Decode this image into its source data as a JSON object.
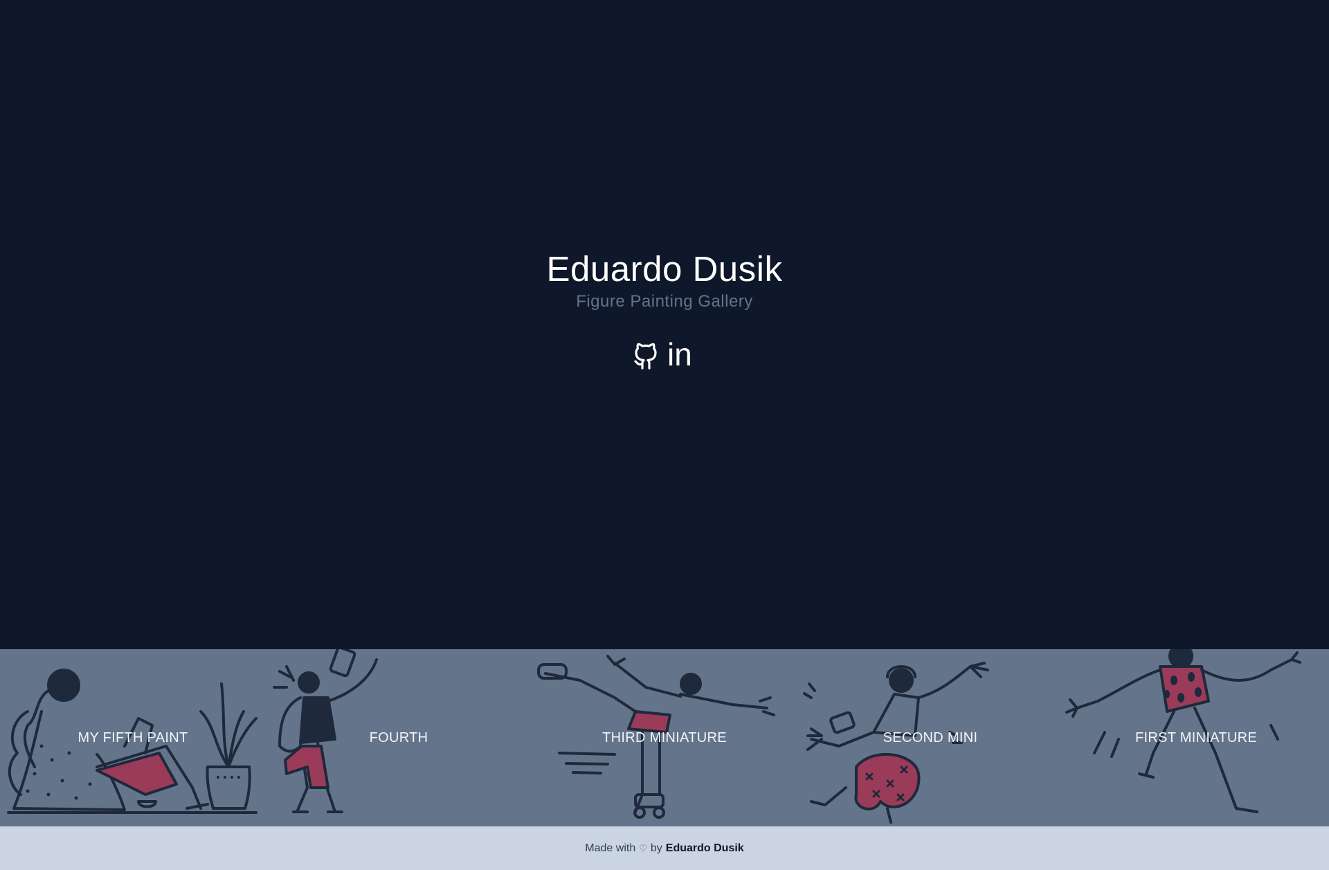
{
  "hero": {
    "title": "Eduardo Dusik",
    "subtitle": "Figure Painting Gallery"
  },
  "social": {
    "links": [
      {
        "icon": "github-icon",
        "label": "GitHub"
      },
      {
        "icon": "linkedin-icon",
        "label": "in"
      }
    ]
  },
  "gallery": {
    "items": [
      {
        "title": "MY FIFTH PAINT"
      },
      {
        "title": "FOURTH"
      },
      {
        "title": "THIRD MINIATURE"
      },
      {
        "title": "SECOND MINI"
      },
      {
        "title": "FIRST MINIATURE"
      }
    ]
  },
  "footer": {
    "made_with": "Made with",
    "heart": "♡",
    "by": "by",
    "author": "Eduardo Dusik"
  },
  "colors": {
    "background": "#0f172a",
    "gallery_bg": "#64748b",
    "footer_bg": "#cbd5e1",
    "subtitle": "#64748b",
    "illustration_line": "#1e293b",
    "illustration_accent": "#9b3b5a"
  }
}
